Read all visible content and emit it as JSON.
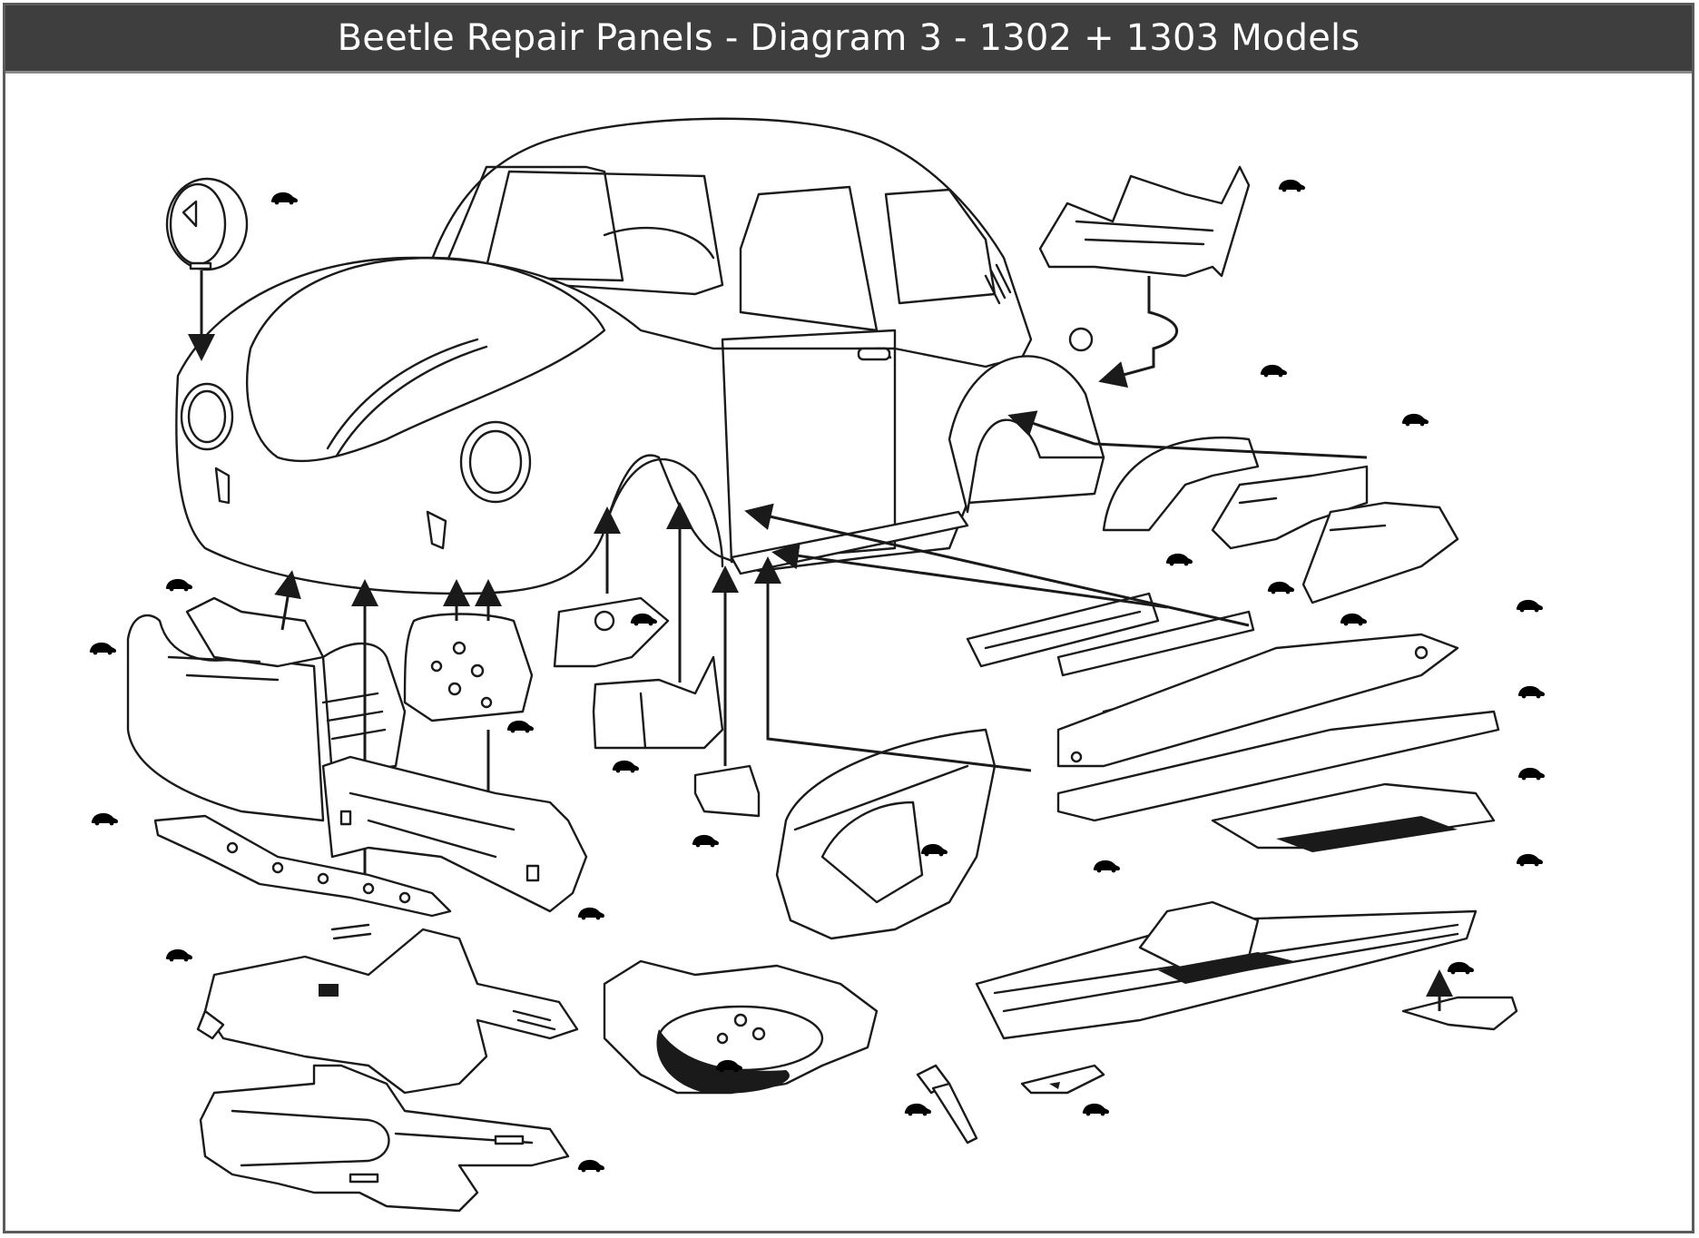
{
  "title": "Beetle Repair Panels - Diagram 3 - 1302 + 1303 Models",
  "colors": {
    "title_bar": "#3e3e3e",
    "title_text": "#ffffff",
    "frame_border": "#5b5b5b",
    "line_art": "#1a1a1a",
    "hotspot_icon": "#efdda0"
  },
  "hotspot_icon": "beetle-car-icon",
  "hotspot_count": 33
}
